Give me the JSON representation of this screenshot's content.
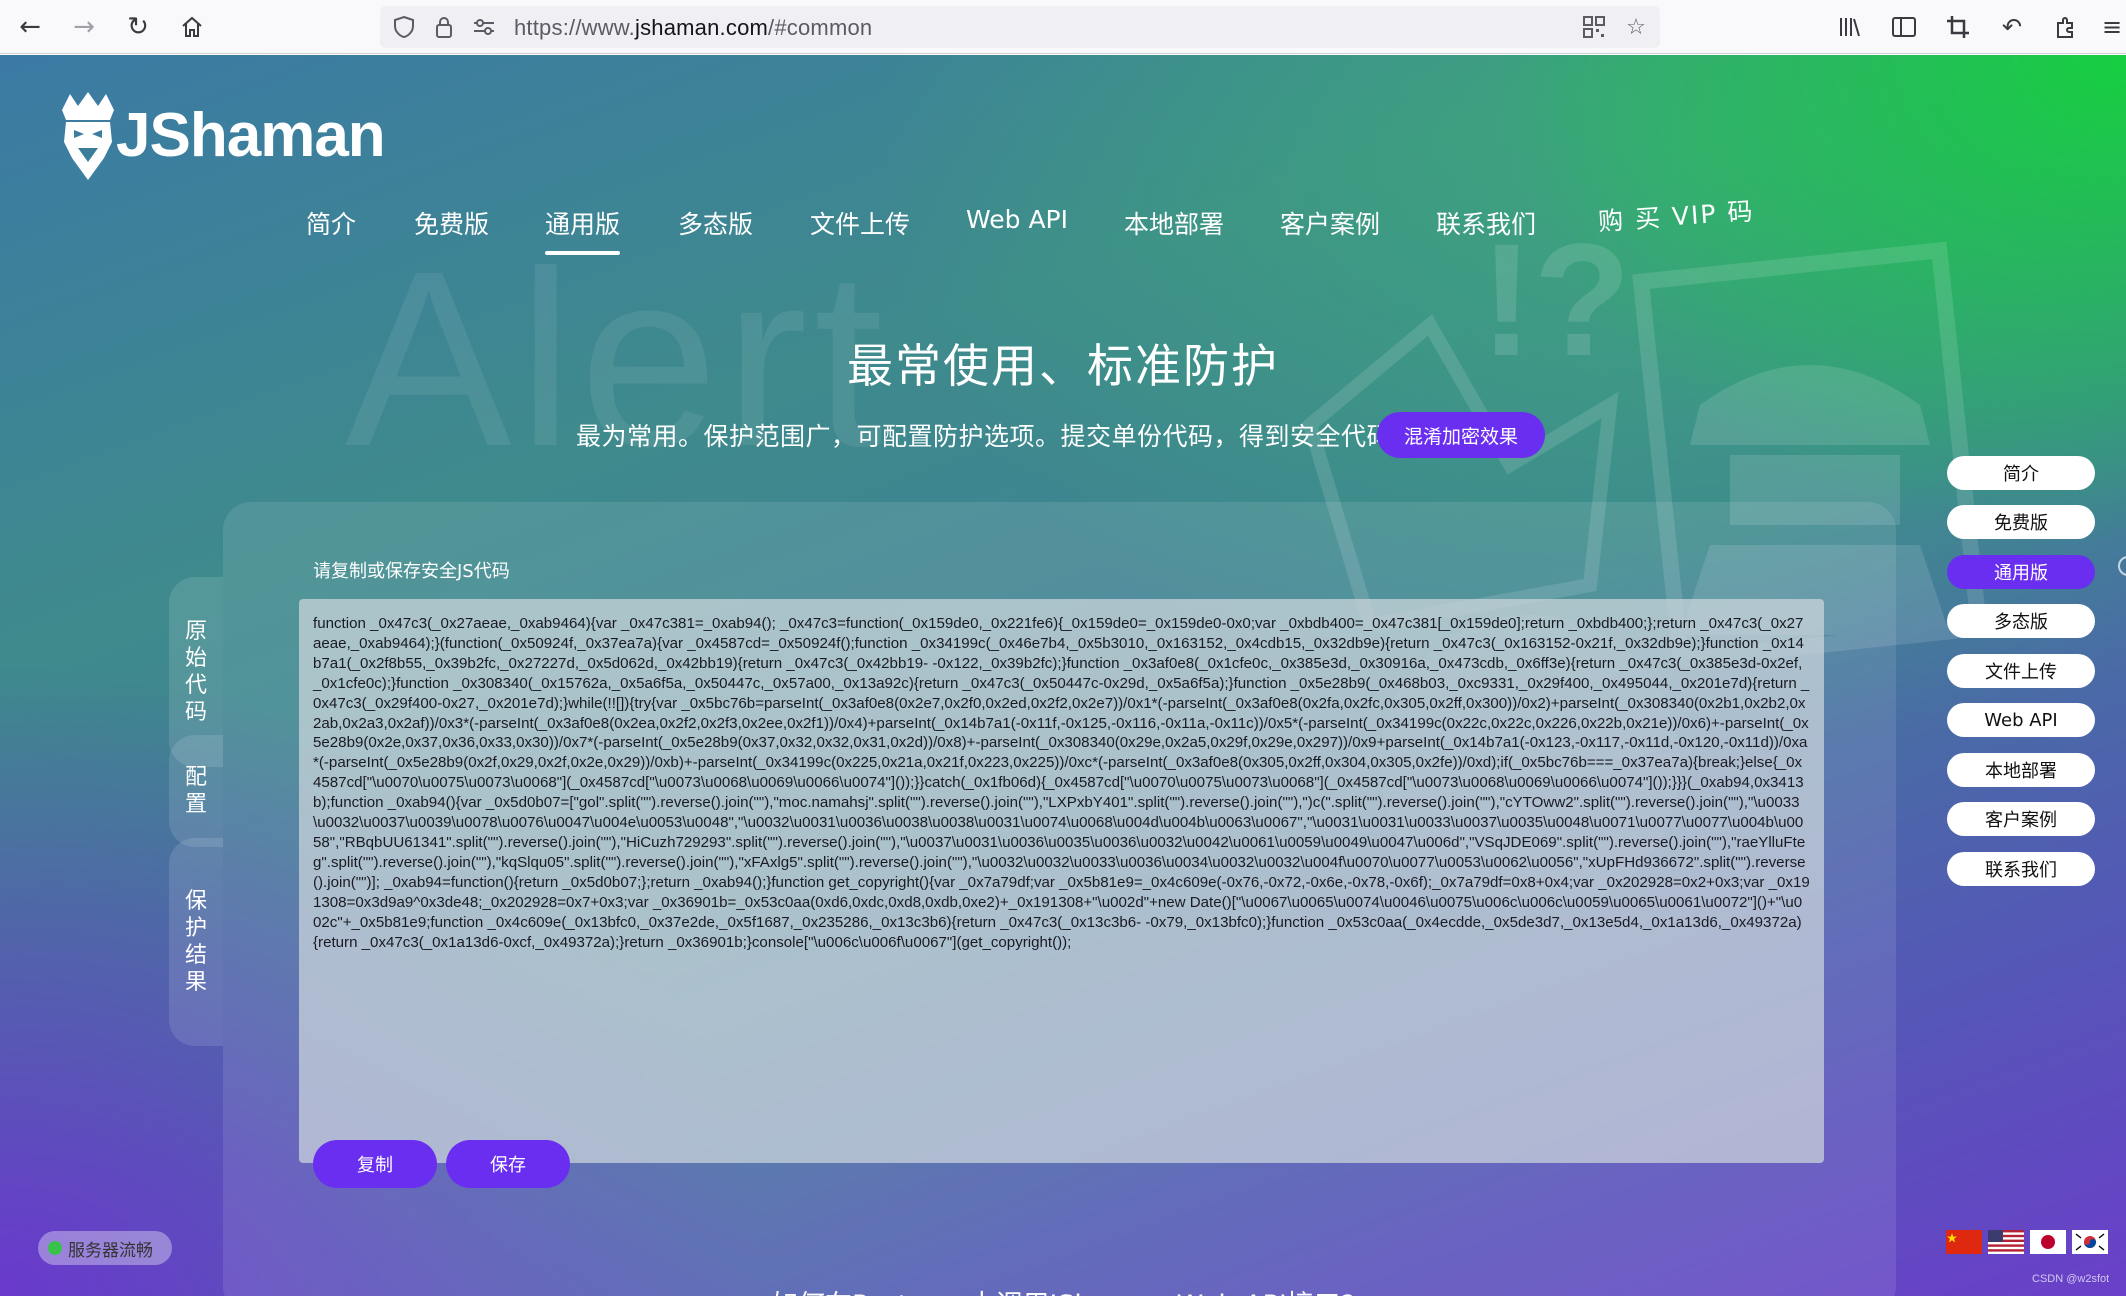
{
  "browser": {
    "url_prefix": "https://www.",
    "url_host": "jshaman.com",
    "url_path": "/#common"
  },
  "logo": {
    "text": "JShaman"
  },
  "nav": {
    "items": [
      "简介",
      "免费版",
      "通用版",
      "多态版",
      "文件上传",
      "Web API",
      "本地部署",
      "客户案例",
      "联系我们"
    ],
    "vip": "购 买 VIP 码",
    "active": "通用版"
  },
  "hero": {
    "background_word": "Alert",
    "title": "最常使用、标准防护",
    "subtitle": "最为常用。保护范围广，可配置防护选项。提交单份代码，得到安全代码。",
    "effect_button": "混淆加密效果"
  },
  "side_tabs": [
    "原始代码",
    "配置",
    "保护结果"
  ],
  "output": {
    "label": "请复制或保存安全JS代码",
    "code": "function _0x47c3(_0x27aeae,_0xab9464){var _0x47c381=_0xab94(); _0x47c3=function(_0x159de0,_0x221fe6){_0x159de0=_0x159de0-0x0;var _0xbdb400=_0x47c381[_0x159de0];return _0xbdb400;};return _0x47c3(_0x27aeae,_0xab9464);}(function(_0x50924f,_0x37ea7a){var _0x4587cd=_0x50924f();function _0x34199c(_0x46e7b4,_0x5b3010,_0x163152,_0x4cdb15,_0x32db9e){return _0x47c3(_0x163152-0x21f,_0x32db9e);}function _0x14b7a1(_0x2f8b55,_0x39b2fc,_0x27227d,_0x5d062d,_0x42bb19){return _0x47c3(_0x42bb19- -0x122,_0x39b2fc);}function _0x3af0e8(_0x1cfe0c,_0x385e3d,_0x30916a,_0x473cdb,_0x6ff3e){return _0x47c3(_0x385e3d-0x2ef,_0x1cfe0c);}function _0x308340(_0x15762a,_0x5a6f5a,_0x50447c,_0x57a00,_0x13a92c){return _0x47c3(_0x50447c-0x29d,_0x5a6f5a);}function _0x5e28b9(_0x468b03,_0xc9331,_0x29f400,_0x495044,_0x201e7d){return _0x47c3(_0x29f400-0x27,_0x201e7d);}while(!![]){try{var _0x5bc76b=parseInt(_0x3af0e8(0x2e7,0x2f0,0x2ed,0x2f2,0x2e7))/0x1*(-parseInt(_0x3af0e8(0x2fa,0x2fc,0x305,0x2ff,0x300))/0x2)+parseInt(_0x308340(0x2b1,0x2b2,0x2ab,0x2a3,0x2af))/0x3*(-parseInt(_0x3af0e8(0x2ea,0x2f2,0x2f3,0x2ee,0x2f1))/0x4)+parseInt(_0x14b7a1(-0x11f,-0x125,-0x116,-0x11a,-0x11c))/0x5*(-parseInt(_0x34199c(0x22c,0x22c,0x226,0x22b,0x21e))/0x6)+-parseInt(_0x5e28b9(0x2e,0x37,0x36,0x33,0x30))/0x7*(-parseInt(_0x5e28b9(0x37,0x32,0x32,0x31,0x2d))/0x8)+-parseInt(_0x308340(0x29e,0x2a5,0x29f,0x29e,0x297))/0x9+parseInt(_0x14b7a1(-0x123,-0x117,-0x11d,-0x120,-0x11d))/0xa*(-parseInt(_0x5e28b9(0x2f,0x29,0x2f,0x2e,0x29))/0xb)+-parseInt(_0x34199c(0x225,0x21a,0x21f,0x223,0x225))/0xc*(-parseInt(_0x3af0e8(0x305,0x2ff,0x304,0x305,0x2fe))/0xd);if(_0x5bc76b===_0x37ea7a){break;}else{_0x4587cd[\"\\u0070\\u0075\\u0073\\u0068\"](_0x4587cd[\"\\u0073\\u0068\\u0069\\u0066\\u0074\"]());}}catch(_0x1fb06d){_0x4587cd[\"\\u0070\\u0075\\u0073\\u0068\"](_0x4587cd[\"\\u0073\\u0068\\u0069\\u0066\\u0074\"]());}}}(_0xab94,0x3413b);function _0xab94(){var _0x5d0b07=[\"gol\".split(\"\").reverse().join(\"\"),\"moc.namahsj\".split(\"\").reverse().join(\"\"),\"LXPxbY401\".split(\"\").reverse().join(\"\"),\")c(\".split(\"\").reverse().join(\"\"),\"cYTOww2\".split(\"\").reverse().join(\"\"),\"\\u0033\\u0032\\u0037\\u0039\\u0078\\u0076\\u0047\\u004e\\u0053\\u0048\",\"\\u0032\\u0031\\u0036\\u0038\\u0038\\u0031\\u0074\\u0068\\u004d\\u004b\\u0063\\u0067\",\"\\u0031\\u0031\\u0033\\u0037\\u0035\\u0048\\u0071\\u0077\\u0077\\u004b\\u0058\",\"RBqbUU61341\".split(\"\").reverse().join(\"\"),\"HiCuzh729293\".split(\"\").reverse().join(\"\"),\"\\u0037\\u0031\\u0036\\u0035\\u0036\\u0032\\u0042\\u0061\\u0059\\u0049\\u0047\\u006d\",\"VSqJDE069\".split(\"\").reverse().join(\"\"),\"raeYlluFteg\".split(\"\").reverse().join(\"\"),\"kqSlqu05\".split(\"\").reverse().join(\"\"),\"xFAxlg5\".split(\"\").reverse().join(\"\"),\"\\u0032\\u0032\\u0033\\u0036\\u0034\\u0032\\u0032\\u004f\\u0070\\u0077\\u0053\\u0062\\u0056\",\"xUpFHd936672\".split(\"\").reverse().join(\"\")]; _0xab94=function(){return _0x5d0b07;};return _0xab94();}function get_copyright(){var _0x7a79df;var _0x5b81e9=_0x4c609e(-0x76,-0x72,-0x6e,-0x78,-0x6f);_0x7a79df=0x8+0x4;var _0x202928=0x2+0x3;var _0x191308=0x3d9a9^0x3de48;_0x202928=0x7+0x3;var _0x36901b=_0x53c0aa(0xd6,0xdc,0xd8,0xdb,0xe2)+_0x191308+\"\\u002d\"+new Date()[\"\\u0067\\u0065\\u0074\\u0046\\u0075\\u006c\\u006c\\u0059\\u0065\\u0061\\u0072\"]()+\"\\u002c\"+_0x5b81e9;function _0x4c609e(_0x13bfc0,_0x37e2de,_0x5f1687,_0x235286,_0x13c3b6){return _0x47c3(_0x13c3b6- -0x79,_0x13bfc0);}function _0x53c0aa(_0x4ecdde,_0x5de3d7,_0x13e5d4,_0x1a13d6,_0x49372a){return _0x47c3(_0x1a13d6-0xcf,_0x49372a);}return _0x36901b;}console[\"\\u006c\\u006f\\u0067\"](get_copyright());",
    "copy_button": "复制",
    "save_button": "保存"
  },
  "quick_nav": [
    "简介",
    "免费版",
    "通用版",
    "多态版",
    "文件上传",
    "Web API",
    "本地部署",
    "客户案例",
    "联系我们"
  ],
  "status": {
    "server": "服务器流畅",
    "color": "#39c24b"
  },
  "watermark": "CSDN @w2sfot",
  "bottom_text": "如何在Postman中调用JShaman Web API接口?",
  "colors": {
    "accent": "#6a2ef0",
    "green_glow": "#14d23c"
  }
}
